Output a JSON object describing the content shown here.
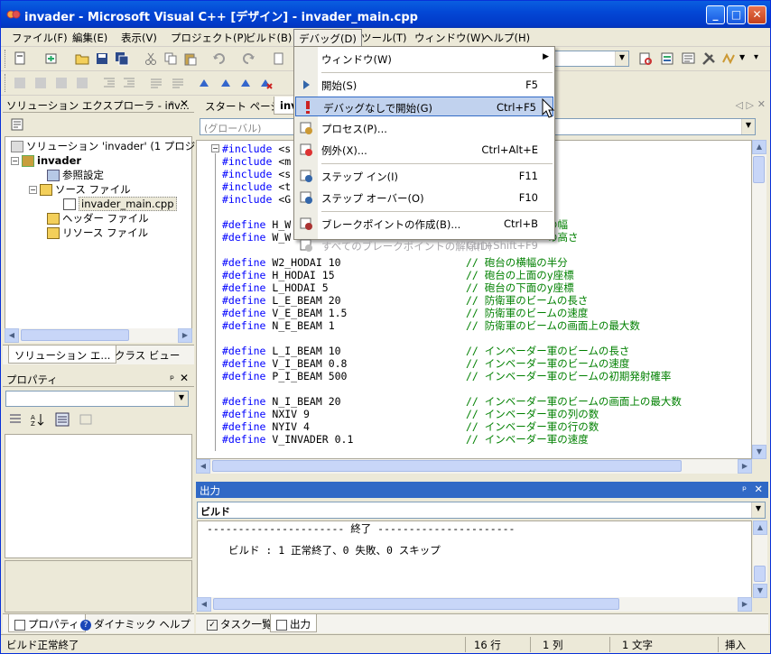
{
  "window": {
    "title": "invader - Microsoft Visual C++ [デザイン] - invader_main.cpp"
  },
  "menu": [
    "ファイル(F)",
    "編集(E)",
    "表示(V)",
    "プロジェクト(P)",
    "ビルド(B)",
    "デバッグ(D)",
    "ツール(T)",
    "ウィンドウ(W)",
    "ヘルプ(H)"
  ],
  "solution_explorer": {
    "title": "ソリューション エクスプローラ - inv...",
    "tree": [
      {
        "label": "ソリューション 'invader' (1 プロジェクト)",
        "level": 0
      },
      {
        "label": "invader",
        "level": 1,
        "bold": true
      },
      {
        "label": "参照設定",
        "level": 2
      },
      {
        "label": "ソース ファイル",
        "level": 2
      },
      {
        "label": "invader_main.cpp",
        "level": 3,
        "selected": true
      },
      {
        "label": "ヘッダー ファイル",
        "level": 2
      },
      {
        "label": "リソース ファイル",
        "level": 2
      }
    ],
    "tabs": [
      "ソリューション エ...",
      "クラス ビュー"
    ]
  },
  "properties": {
    "title": "プロパティ",
    "tabs": [
      "プロパティ",
      "ダイナミック ヘルプ"
    ]
  },
  "editor": {
    "tabs": [
      "スタート ページ",
      "inv"
    ],
    "scope_combo": "(グローバル)",
    "lines": [
      {
        "t": "#include <s",
        "c": ""
      },
      {
        "t": "#include <m",
        "c": ""
      },
      {
        "t": "#include <s",
        "c": ""
      },
      {
        "t": "#include <t",
        "c": ""
      },
      {
        "t": "#include <G",
        "c": ""
      },
      {
        "t": "",
        "c": ""
      },
      {
        "t": "#define H_W",
        "c": "の幅"
      },
      {
        "t": "#define W_W",
        "c": "の高さ"
      },
      {
        "t": "",
        "c": ""
      },
      {
        "t": "#define W2_HODAI 10",
        "c": "// 砲台の横幅の半分"
      },
      {
        "t": "#define H_HODAI 15",
        "c": "// 砲台の上面のy座標"
      },
      {
        "t": "#define L_HODAI 5",
        "c": "// 砲台の下面のy座標"
      },
      {
        "t": "#define L_E_BEAM 20",
        "c": "// 防衛軍のビームの長さ"
      },
      {
        "t": "#define V_E_BEAM 1.5",
        "c": "// 防衛軍のビームの速度"
      },
      {
        "t": "#define N_E_BEAM 1",
        "c": "// 防衛軍のビームの画面上の最大数"
      },
      {
        "t": "",
        "c": ""
      },
      {
        "t": "#define L_I_BEAM 10",
        "c": "// インベーダー軍のビームの長さ"
      },
      {
        "t": "#define V_I_BEAM 0.8",
        "c": "// インベーダー軍のビームの速度"
      },
      {
        "t": "#define P_I_BEAM 500",
        "c": "// インベーダー軍のビームの初期発射確率"
      },
      {
        "t": "",
        "c": ""
      },
      {
        "t": "#define N_I_BEAM 20",
        "c": "// インベーダー軍のビームの画面上の最大数"
      },
      {
        "t": "#define NXIV 9",
        "c": "// インベーダー軍の列の数"
      },
      {
        "t": "#define NYIV 4",
        "c": "// インベーダー軍の行の数"
      },
      {
        "t": "#define V_INVADER 0.1",
        "c": "// インベーダー軍の速度"
      }
    ]
  },
  "output": {
    "title": "出力",
    "combo": "ビルド",
    "line1": "---------------------- 終了 ----------------------",
    "line2": "ビルド : 1 正常終了、0 失敗、0 スキップ",
    "tabs": [
      "タスク一覧",
      "出力"
    ]
  },
  "debug_menu": {
    "items": [
      {
        "label": "ウィンドウ(W)",
        "shortcut": "",
        "submenu": true,
        "icon": ""
      },
      {
        "sep": true
      },
      {
        "label": "開始(S)",
        "shortcut": "F5",
        "icon": "play-icon"
      },
      {
        "label": "デバッグなしで開始(G)",
        "shortcut": "Ctrl+F5",
        "icon": "exclamation-icon",
        "highlighted": true
      },
      {
        "label": "プロセス(P)...",
        "shortcut": "",
        "icon": "process-icon"
      },
      {
        "label": "例外(X)...",
        "shortcut": "Ctrl+Alt+E",
        "icon": "exception-icon"
      },
      {
        "sep": true
      },
      {
        "label": "ステップ イン(I)",
        "shortcut": "F11",
        "icon": "step-into-icon"
      },
      {
        "label": "ステップ オーバー(O)",
        "shortcut": "F10",
        "icon": "step-over-icon"
      },
      {
        "sep": true
      },
      {
        "label": "ブレークポイントの作成(B)...",
        "shortcut": "Ctrl+B",
        "icon": "breakpoint-icon"
      },
      {
        "label": "すべてのブレークポイントの解除(D)",
        "shortcut": "Ctrl+Shift+F9",
        "icon": "clear-breakpoints-icon",
        "disabled": true
      }
    ]
  },
  "statusbar": {
    "message": "ビルド正常終了",
    "line": "16 行",
    "col": "1 列",
    "char": "1 文字",
    "mode": "挿入"
  }
}
